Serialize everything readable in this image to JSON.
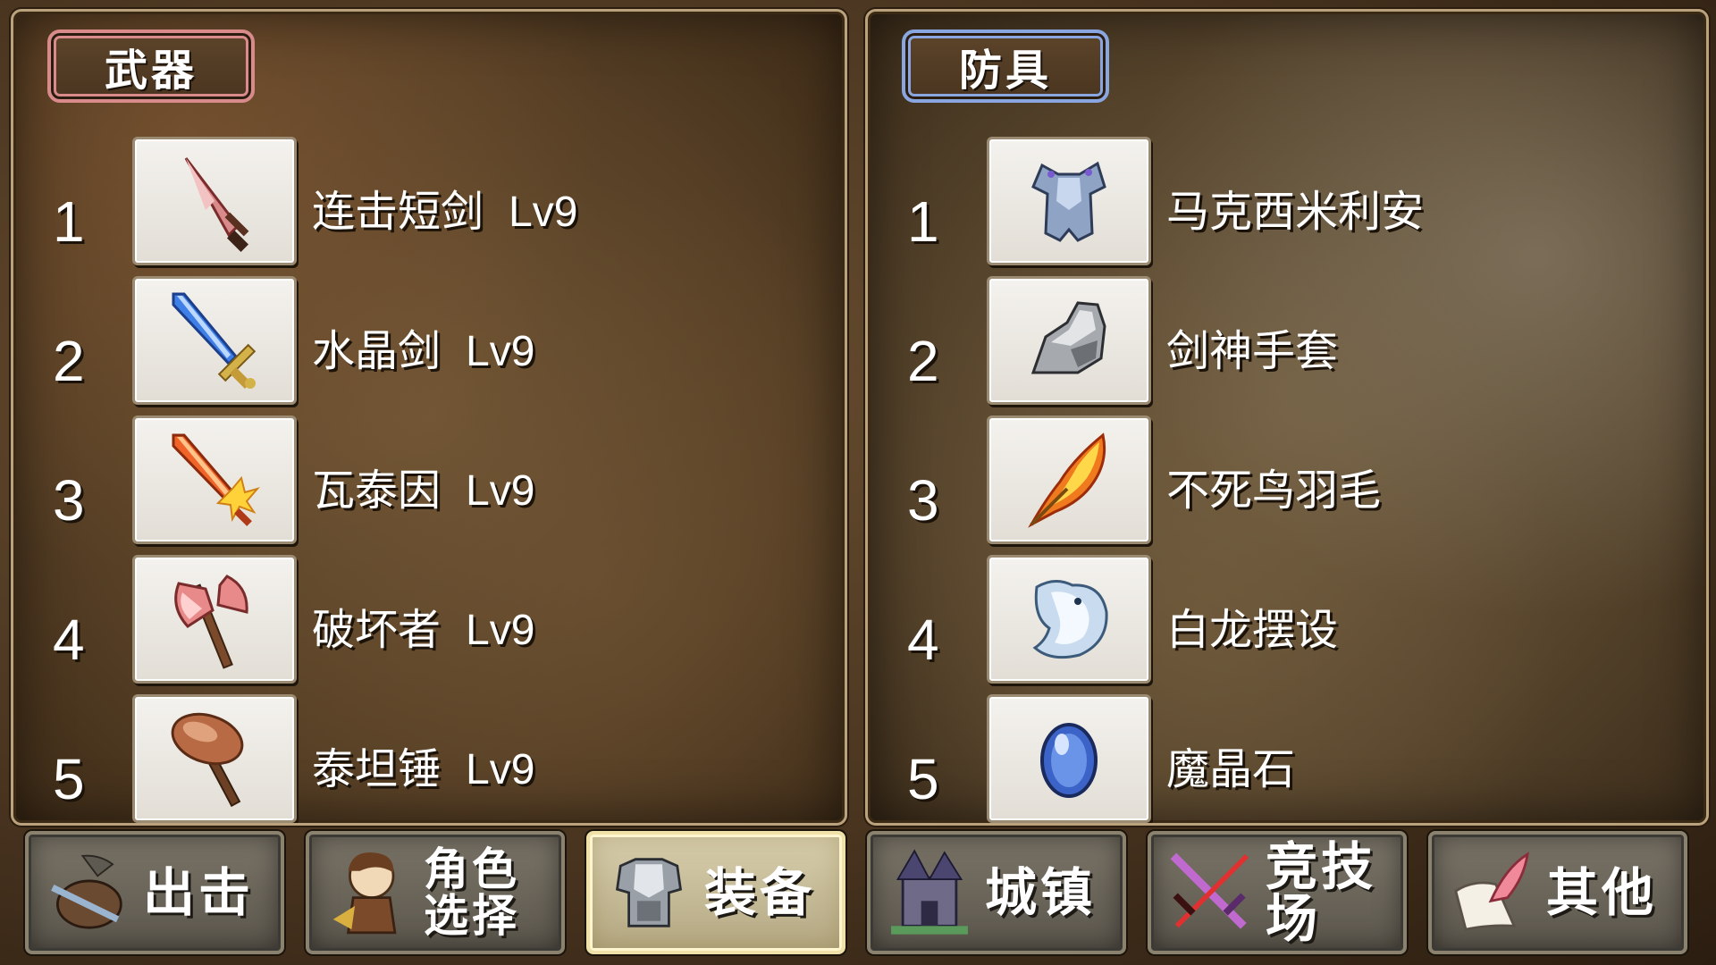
{
  "weapons_panel": {
    "title": "武器",
    "accent": "#d98a8a",
    "items": [
      {
        "num": "1",
        "name": "连击短剑",
        "level": "Lv9",
        "icon": "dagger-icon"
      },
      {
        "num": "2",
        "name": "水晶剑",
        "level": "Lv9",
        "icon": "crystal-sword-icon"
      },
      {
        "num": "3",
        "name": "瓦泰因",
        "level": "Lv9",
        "icon": "flame-sword-icon"
      },
      {
        "num": "4",
        "name": "破坏者",
        "level": "Lv9",
        "icon": "battle-axe-icon"
      },
      {
        "num": "5",
        "name": "泰坦锤",
        "level": "Lv9",
        "icon": "hammer-icon"
      }
    ]
  },
  "armor_panel": {
    "title": "防具",
    "accent": "#8aa6e0",
    "items": [
      {
        "num": "1",
        "name": "马克西米利安",
        "icon": "plate-armor-icon"
      },
      {
        "num": "2",
        "name": "剑神手套",
        "icon": "gauntlet-icon"
      },
      {
        "num": "3",
        "name": "不死鸟羽毛",
        "icon": "phoenix-feather-icon"
      },
      {
        "num": "4",
        "name": "白龙摆设",
        "icon": "white-dragon-icon"
      },
      {
        "num": "5",
        "name": "魔晶石",
        "icon": "mana-crystal-icon"
      }
    ]
  },
  "nav": {
    "sortie": "出击",
    "character_select": "角色选择",
    "equipment": "装备",
    "town": "城镇",
    "arena": "竞技场",
    "other": "其他",
    "active": "equipment"
  }
}
